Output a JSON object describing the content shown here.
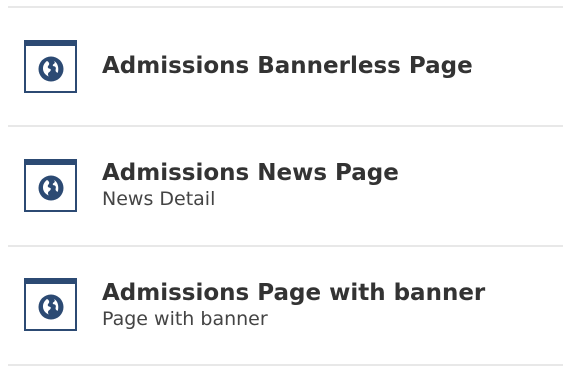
{
  "items": [
    {
      "title": "Admissions Bannerless Page",
      "subtitle": "",
      "icon": "globe-page-icon"
    },
    {
      "title": "Admissions News Page",
      "subtitle": "News Detail",
      "icon": "globe-page-icon"
    },
    {
      "title": "Admissions Page with banner",
      "subtitle": "Page with banner",
      "icon": "globe-page-icon"
    }
  ],
  "colors": {
    "icon_accent": "#2c4a73",
    "divider": "#e8e8e8",
    "title_text": "#333333"
  }
}
